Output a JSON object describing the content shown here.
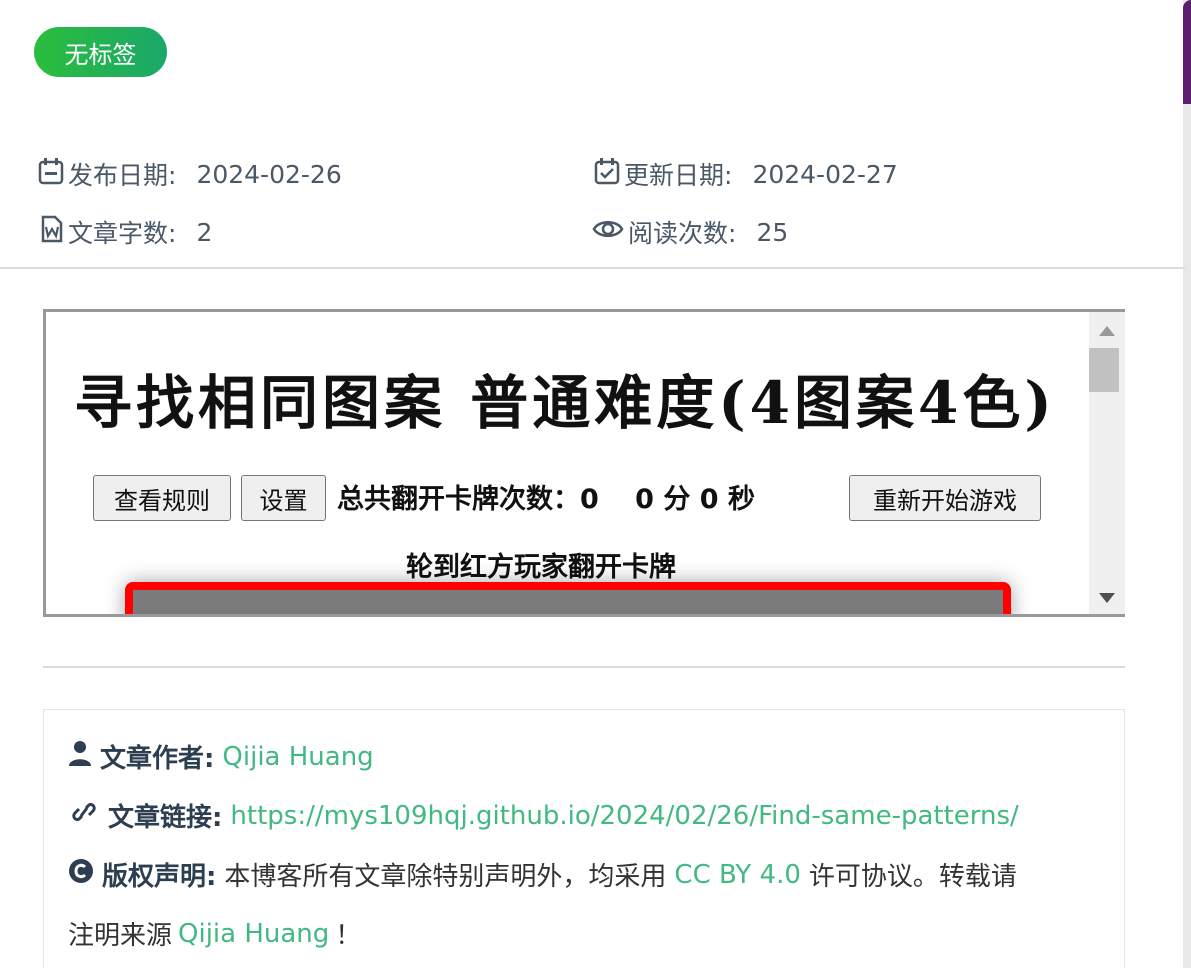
{
  "tag": {
    "label": "无标签"
  },
  "meta": {
    "publish_label": "发布日期:",
    "publish_value": "2024-02-26",
    "update_label": "更新日期:",
    "update_value": "2024-02-27",
    "words_label": "文章字数:",
    "words_value": "2",
    "views_label": "阅读次数:",
    "views_value": "25"
  },
  "game": {
    "title": "寻找相同图案 普通难度(4图案4色)",
    "rules_button": "查看规则",
    "settings_button": "设置",
    "counter_text": "总共翻开卡牌次数：0 　0 分 0 秒",
    "restart_button": "重新开始游戏",
    "turn_text": "轮到红方玩家翻开卡牌",
    "board_border_color": "#ff0000"
  },
  "copyright": {
    "author_label": "文章作者:",
    "author_value": "Qijia Huang",
    "link_label": "文章链接:",
    "link_value": "https://mys109hqj.github.io/2024/02/26/Find-same-patterns/",
    "license_label": "版权声明:",
    "license_text_1": "本博客所有文章除特别声明外，均采用",
    "license_link": "CC BY 4.0",
    "license_text_2": "许可协议。转载请",
    "license_text_3": "注明来源",
    "license_source": "Qijia Huang",
    "license_end": "！"
  },
  "colors": {
    "accent": "#42b983",
    "tag_start": "#2bbd3c",
    "tag_end": "#1aa86a"
  }
}
